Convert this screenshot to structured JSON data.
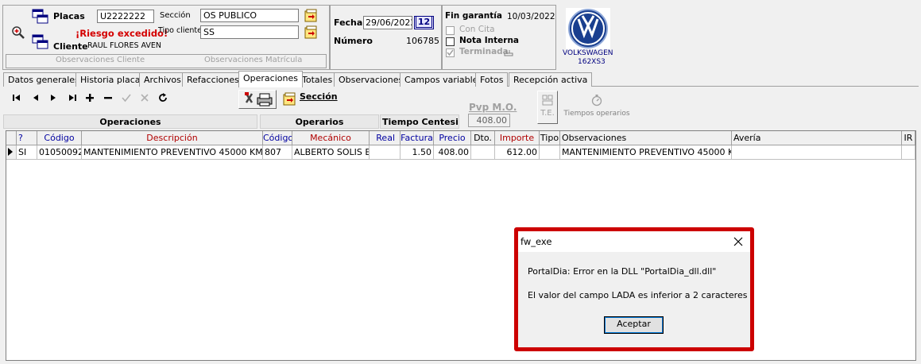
{
  "header": {
    "placas_label": "Placas",
    "placas_value": "U2222222",
    "seccion_label": "Sección",
    "seccion_value": "OS PUBLICO",
    "riesgo_text": "¡Riesgo excedido!",
    "tipo_cliente_label": "Tipo cliente",
    "tipo_cliente_value": "SS",
    "cliente_label": "Cliente",
    "cliente_value": "RAUL FLORES AVEN",
    "obs_cliente": "Observaciones  Cliente",
    "obs_matricula": "Observaciones  Matrícula",
    "fecha_label": "Fecha",
    "fecha_value": "29/06/2022",
    "calendar_label": "12",
    "numero_label": "Número",
    "numero_value": "106785",
    "fin_garantia_label": "Fin garantía",
    "fin_garantia_value": "10/03/2022",
    "con_cita_label": "Con Cita",
    "nota_interna_label": "Nota Interna",
    "terminada_label": "Terminada",
    "brand_name": "VOLKSWAGEN",
    "brand_code": "162XS3"
  },
  "tabs": [
    {
      "label": "Datos generales"
    },
    {
      "label": "Historia placas"
    },
    {
      "label": "Archivos"
    },
    {
      "label": "Refacciones"
    },
    {
      "label": "Operaciones"
    },
    {
      "label": "Totales"
    },
    {
      "label": "Observaciones"
    },
    {
      "label": "Campos variables"
    },
    {
      "label": "Fotos"
    },
    {
      "label": "Recepción activa"
    }
  ],
  "toolbar": {
    "seccion_link": "Sección",
    "pvp_label": "Pvp M.O.",
    "pvp_value": "408.00",
    "te_label": "T.E.",
    "tiempos_label": "Tiempos operarios"
  },
  "section_headers": {
    "operaciones": "Operaciones",
    "operarios": "Operarios",
    "tiempo": "Tiempo Centesimal"
  },
  "grid": {
    "columns": [
      "?",
      "Código",
      "Descripción",
      "Código",
      "Mecánico",
      "Real",
      "Factura",
      "Precio",
      "Dto.",
      "Importe",
      "Tipo",
      "Observaciones",
      "Avería",
      "IR"
    ],
    "row": {
      "q": "SI",
      "codigo": "01050092",
      "descripcion": "MANTENIMIENTO PREVENTIVO 45000 KM",
      "codigo_mec": "807",
      "mecanico": "ALBERTO SOLIS E",
      "real": "",
      "factura": "1.50",
      "precio": "408.00",
      "dto": "",
      "importe": "612.00",
      "tipo": "",
      "observaciones": "MANTENIMIENTO PREVENTIVO 45000 KM",
      "averia": "",
      "ir": ""
    }
  },
  "dialog": {
    "title": "fw_exe",
    "line1": "PortalDia:  Error en la DLL \"PortalDia_dll.dll\"",
    "line2": "El valor del campo LADA es inferior a 2 caracteres",
    "button": "Aceptar"
  },
  "colors": {
    "accent_red": "#d40000",
    "header_red": "#b00000",
    "header_blue": "#0000a0",
    "dialog_border": "#cc0000"
  }
}
